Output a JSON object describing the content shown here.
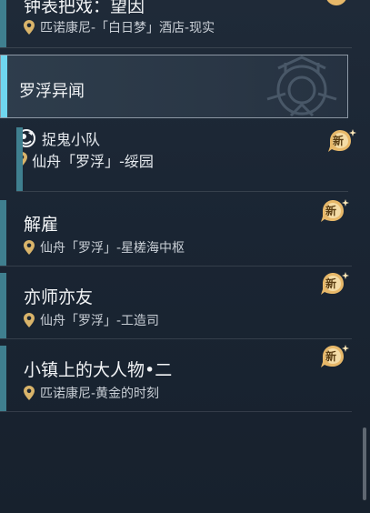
{
  "quests": [
    {
      "title": "钟表把戏：望因",
      "location": "匹诺康尼-「白日梦」酒店-现实"
    },
    {
      "category": "罗浮异闻"
    },
    {
      "title": "捉鬼小队",
      "location": "仙舟「罗浮」-绥园",
      "badge": "新"
    },
    {
      "title": "解雇",
      "location": "仙舟「罗浮」-星槎海中枢",
      "badge": "新"
    },
    {
      "title": "亦师亦友",
      "location": "仙舟「罗浮」-工造司",
      "badge": "新"
    },
    {
      "title": "小镇上的大人物•二",
      "location": "匹诺康尼-黄金的时刻",
      "badge": "新"
    }
  ],
  "icons": {
    "location": "map-pin-icon",
    "quest": "ghost-hunt-icon",
    "new": "new-badge-icon"
  },
  "colors": {
    "accent_bar": "#3f7f8f",
    "category_accent": "#6fd6ef",
    "location_pin": "#d9b46a",
    "badge_gold": "#e7b869"
  }
}
